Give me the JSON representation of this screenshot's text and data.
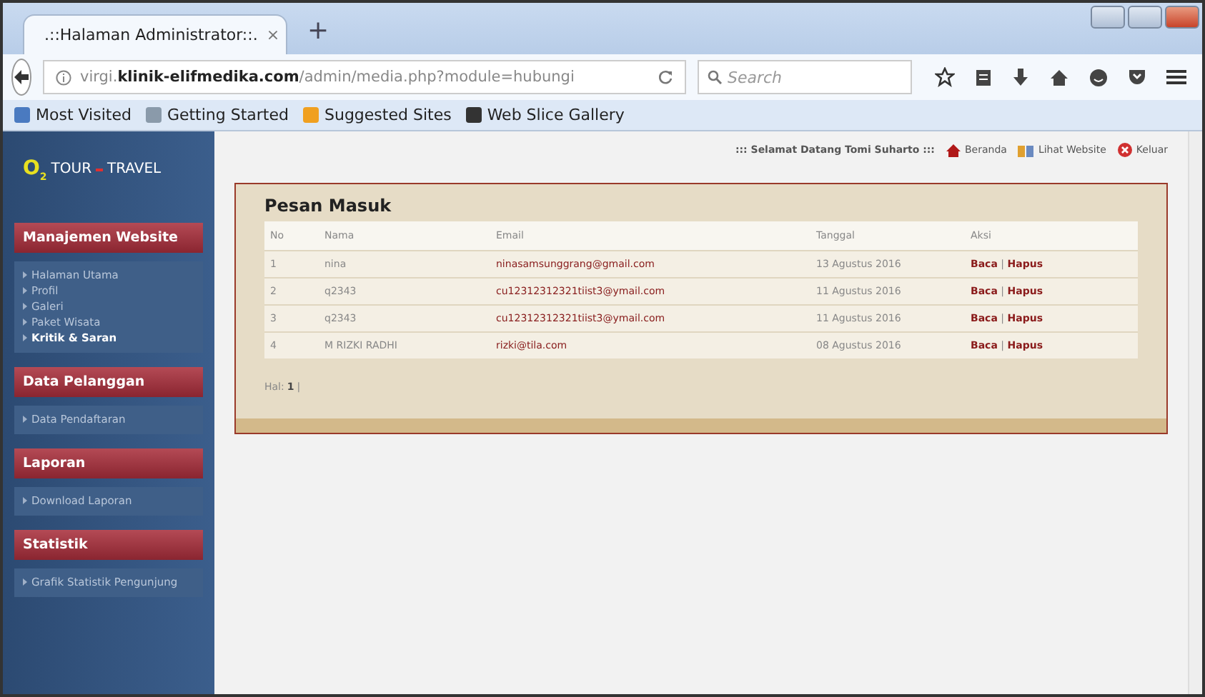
{
  "browser": {
    "tab_title": ".::Halaman Administrator::.",
    "tab_close": "×",
    "new_tab": "+",
    "url_prefix": "virgi.",
    "url_domain": "klinik-elifmedika.com",
    "url_path": "/admin/media.php?module=hubungi",
    "search_placeholder": "Search",
    "bookmarks": [
      "Most Visited",
      "Getting Started",
      "Suggested Sites",
      "Web Slice Gallery"
    ]
  },
  "logo": {
    "mark": "O",
    "sub": "2",
    "word1": "TOUR",
    "word2": "TRAVEL"
  },
  "header": {
    "welcome": "::: Selamat Datang Tomi Suharto :::",
    "links": [
      {
        "label": "Beranda",
        "kind": "home"
      },
      {
        "label": "Lihat Website",
        "kind": "book"
      },
      {
        "label": "Keluar",
        "kind": "exit"
      }
    ]
  },
  "sidebar": [
    {
      "title": "Manajemen Website",
      "items": [
        {
          "label": "Halaman Utama",
          "selected": false
        },
        {
          "label": "Profil",
          "selected": false
        },
        {
          "label": "Galeri",
          "selected": false
        },
        {
          "label": "Paket Wisata",
          "selected": false
        },
        {
          "label": "Kritik & Saran",
          "selected": true
        }
      ]
    },
    {
      "title": "Data Pelanggan",
      "items": [
        {
          "label": "Data Pendaftaran",
          "selected": false
        }
      ]
    },
    {
      "title": "Laporan",
      "items": [
        {
          "label": "Download Laporan",
          "selected": false
        }
      ]
    },
    {
      "title": "Statistik",
      "items": [
        {
          "label": "Grafik Statistik Pengunjung",
          "selected": false
        }
      ]
    }
  ],
  "panel": {
    "title": "Pesan Masuk",
    "columns": [
      "No",
      "Nama",
      "Email",
      "Tanggal",
      "Aksi"
    ],
    "rows": [
      {
        "no": "1",
        "nama": "nina",
        "email": "ninasamsunggrang@gmail.com",
        "tanggal": "13 Agustus 2016",
        "read": "Baca",
        "sep": "|",
        "delete": "Hapus"
      },
      {
        "no": "2",
        "nama": "q2343",
        "email": "cu12312312321tiist3@ymail.com",
        "tanggal": "11 Agustus 2016",
        "read": "Baca",
        "sep": "|",
        "delete": "Hapus"
      },
      {
        "no": "3",
        "nama": "q2343",
        "email": "cu12312312321tiist3@ymail.com",
        "tanggal": "11 Agustus 2016",
        "read": "Baca",
        "sep": "|",
        "delete": "Hapus"
      },
      {
        "no": "4",
        "nama": "M RIZKI RADHI",
        "email": "rizki@tila.com",
        "tanggal": "08 Agustus 2016",
        "read": "Baca",
        "sep": "|",
        "delete": "Hapus"
      }
    ],
    "pager_label": "Hal:",
    "pages": [
      {
        "label": "1",
        "selected": true
      }
    ],
    "pager_sep": "|"
  }
}
